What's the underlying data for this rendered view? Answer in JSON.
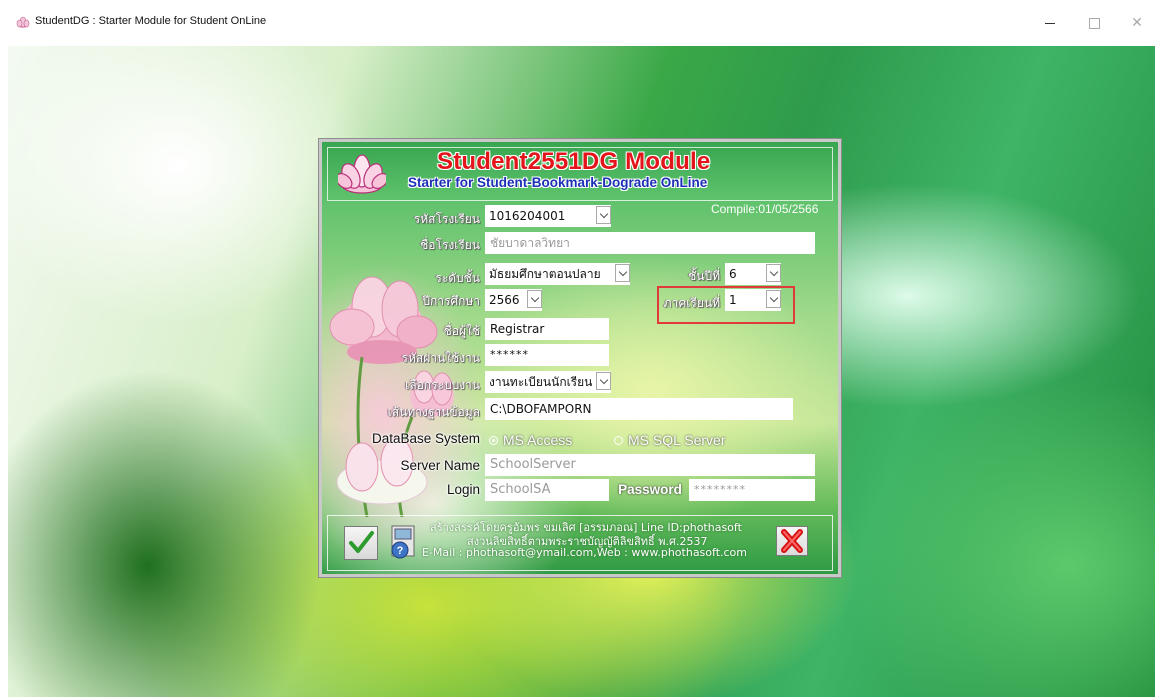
{
  "window": {
    "title": "StudentDG : Starter Module for Student OnLine",
    "minimize": "—",
    "maximize": "☐",
    "close": "✕"
  },
  "header": {
    "title": "Student2551DG Module",
    "subtitle": "Starter for Student-Bookmark-Dograde OnLine",
    "compile": "Compile:01/05/2566"
  },
  "form": {
    "school_code": {
      "label": "รหัสโรงเรียน",
      "value": "1016204001"
    },
    "school_name": {
      "label": "ชื่อโรงเรียน",
      "value": "ชัยบาดาลวิทยา"
    },
    "level": {
      "label": "ระดับชั้น",
      "value": "มัธยมศึกษาตอนปลาย"
    },
    "grade": {
      "label": "ชั้นปีที่",
      "value": "6"
    },
    "academic_year": {
      "label": "ปีการศึกษา",
      "value": "2566"
    },
    "semester": {
      "label": "ภาคเรียนที่",
      "value": "1"
    },
    "username": {
      "label": "ชื่อผู้ใช้",
      "value": "Registrar"
    },
    "password": {
      "label": "รหัสผ่านใช้งาน",
      "value": "******"
    },
    "subsystem": {
      "label": "เลือกระบบงาน",
      "value": "งานทะเบียนนักเรียน"
    },
    "db_path": {
      "label": "เส้นทางฐานข้อมูล",
      "value": "C:\\DBOFAMPORN"
    },
    "db_system": {
      "label": "DataBase System",
      "options": [
        "MS Access",
        "MS SQL Server"
      ],
      "selected": "MS Access"
    },
    "server_name": {
      "label": "Server Name",
      "value": "SchoolServer"
    },
    "login": {
      "label": "Login",
      "value": "SchoolSA"
    },
    "sql_password": {
      "label": "Password",
      "value": "********"
    }
  },
  "footer": {
    "line1": "สร้างสรรค์โดยครูอัมพร  ขมเลิศ [อรรมภอณ] Line ID:phothasoft",
    "line2": "สงวนลิขสิทธิ์ตามพระราชบัญญัติลิขสิทธิ์ พ.ศ.2537",
    "line3": "E-Mail : phothasoft@ymail.com,Web : www.phothasoft.com"
  },
  "colors": {
    "title_red": "#e3151b",
    "subtitle_blue": "#1b2fb8",
    "highlight": "#e03a3a"
  },
  "icons": [
    "lotus-logo-icon",
    "checkmark-icon",
    "settings-icon",
    "red-x-icon"
  ]
}
